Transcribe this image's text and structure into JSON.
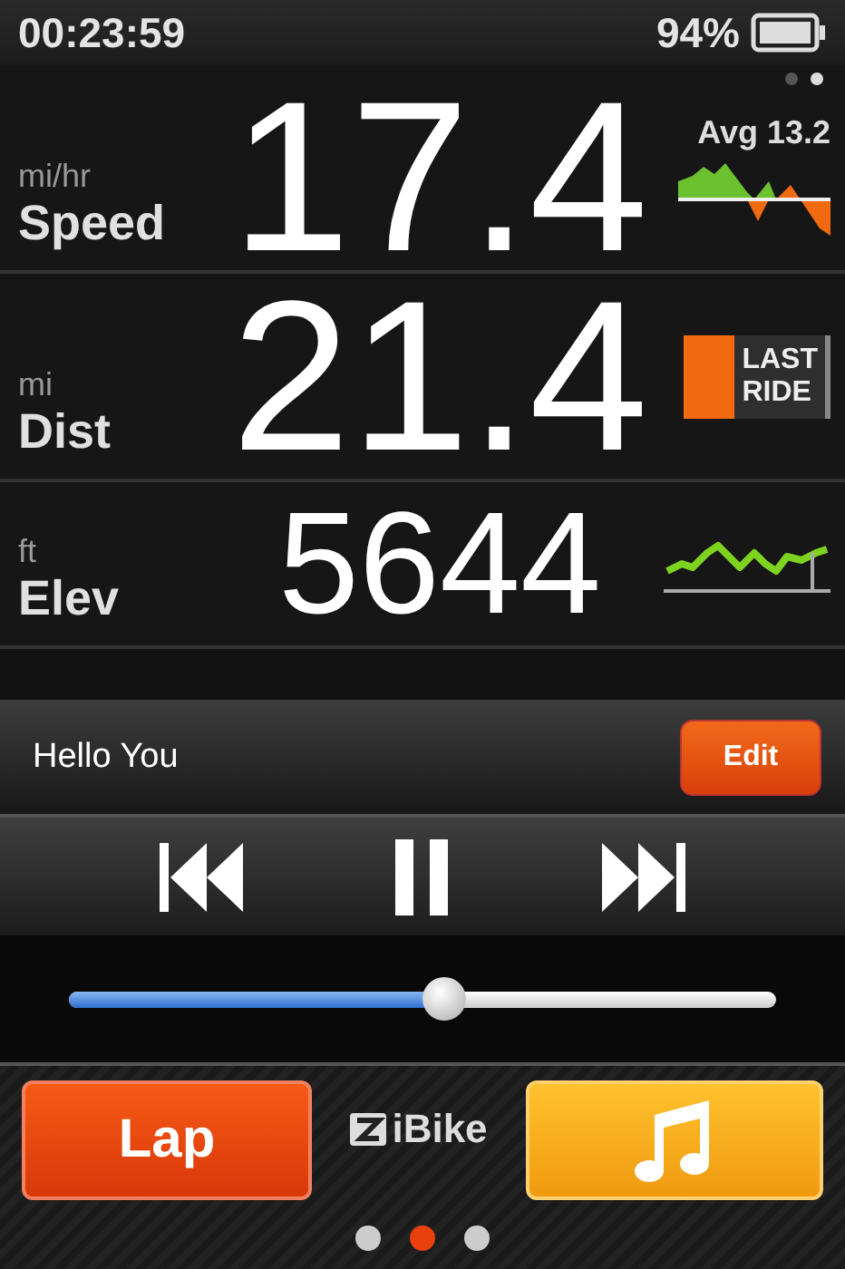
{
  "status_bar": {
    "time": "00:23:59",
    "battery": "94%"
  },
  "top_page_dots": [
    {
      "selected": false
    },
    {
      "selected": true
    }
  ],
  "metrics": [
    {
      "kind": "avg_chart",
      "unit": "mi/hr",
      "name": "Speed",
      "value": "17.4",
      "avg": "Avg 13.2"
    },
    {
      "kind": "last_ride",
      "unit": "mi",
      "name": "Dist",
      "value": "21.4",
      "badge": [
        "LAST",
        "RIDE"
      ]
    },
    {
      "kind": "sparkline",
      "unit": "ft",
      "name": "Elev",
      "value": "5644"
    }
  ],
  "music_overlay": {
    "now_playing": "Hello You",
    "edit": "Edit",
    "volume": {
      "level": 0.53
    }
  },
  "footer": {
    "lap": "Lap",
    "logo": "iBike",
    "page_dots": [
      {
        "selected": false
      },
      {
        "selected": true
      },
      {
        "selected": false
      }
    ]
  }
}
